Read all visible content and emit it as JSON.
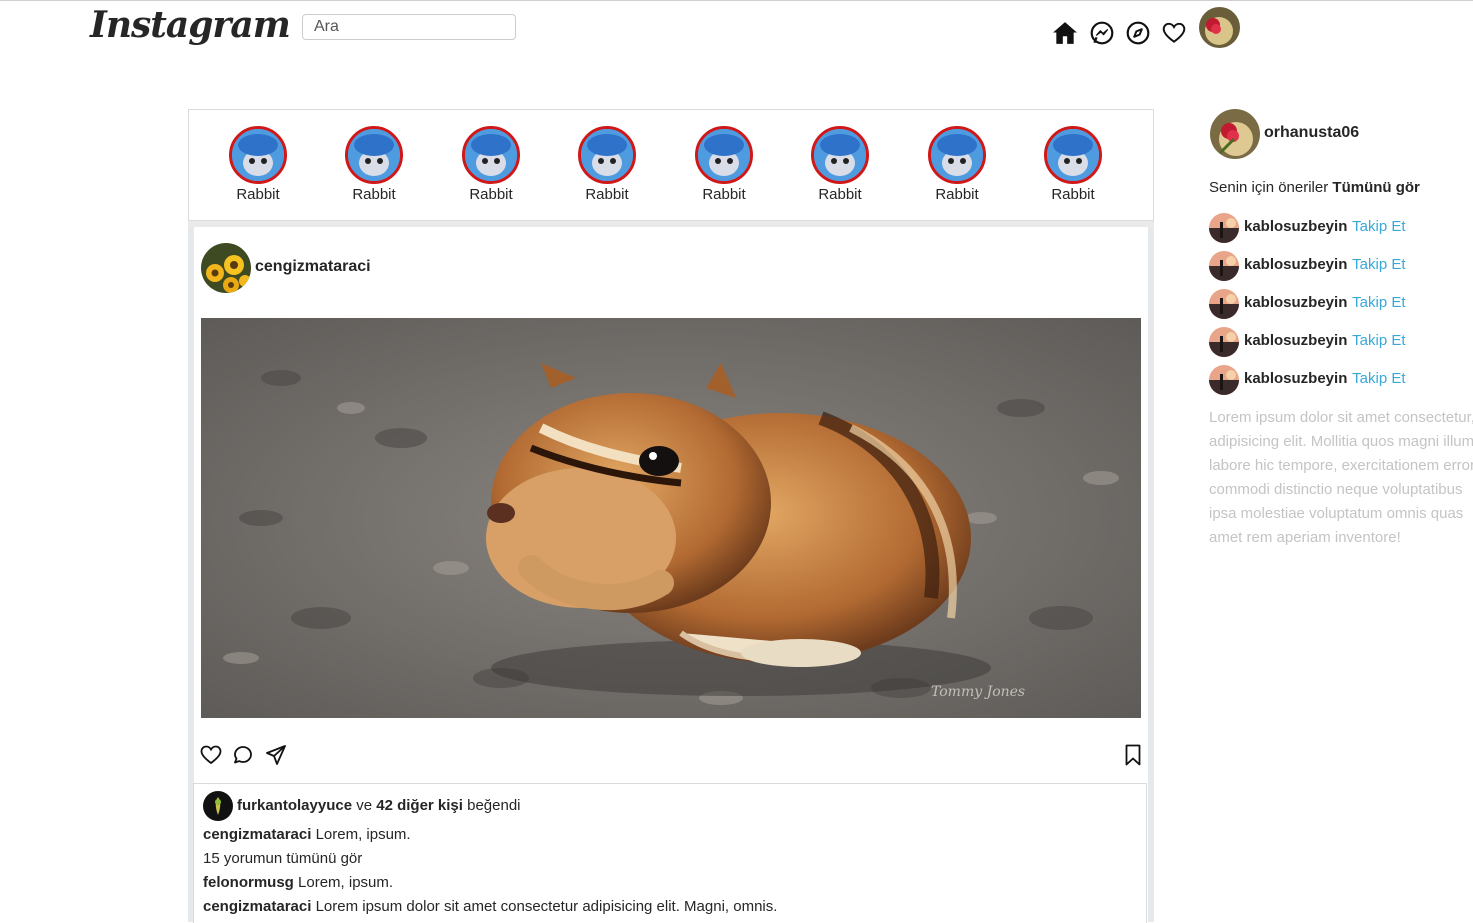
{
  "header": {
    "logo_text": "Instagram",
    "search_placeholder": "Ara",
    "icons": [
      "home-icon",
      "messenger-icon",
      "explore-icon",
      "heart-icon",
      "profile-avatar"
    ]
  },
  "stories": [
    {
      "label": "Rabbit"
    },
    {
      "label": "Rabbit"
    },
    {
      "label": "Rabbit"
    },
    {
      "label": "Rabbit"
    },
    {
      "label": "Rabbit"
    },
    {
      "label": "Rabbit"
    },
    {
      "label": "Rabbit"
    },
    {
      "label": "Rabbit"
    }
  ],
  "post": {
    "username": "cengizmataraci",
    "likes": {
      "liker": "furkantolayyuce",
      "connector": "ve",
      "others": "42 diğer kişi",
      "suffix": "beğendi"
    },
    "caption": {
      "user": "cengizmataraci",
      "text": "Lorem, ipsum."
    },
    "view_all_comments": "15 yorumun tümünü gör",
    "comments": [
      {
        "user": "felonormusg",
        "text": "Lorem, ipsum."
      },
      {
        "user": "cengizmataraci",
        "text": "Lorem ipsum dolor sit amet consectetur adipisicing elit. Magni, omnis."
      }
    ],
    "image_watermark": "Tommy Jones"
  },
  "sidebar": {
    "username": "orhanusta06",
    "suggestions_label": "Senin için öneriler",
    "see_all": "Tümünü gör",
    "suggestions": [
      {
        "username": "kablosuzbeyin",
        "action": "Takip Et"
      },
      {
        "username": "kablosuzbeyin",
        "action": "Takip Et"
      },
      {
        "username": "kablosuzbeyin",
        "action": "Takip Et"
      },
      {
        "username": "kablosuzbeyin",
        "action": "Takip Et"
      },
      {
        "username": "kablosuzbeyin",
        "action": "Takip Et"
      }
    ],
    "footer_text": "Lorem ipsum dolor sit amet consectetur, adipisicing elit. Mollitia quos magni illum labore hic tempore, exercitationem error, commodi distinctio neque voluptatibus ipsa molestiae voluptatum omnis quas amet rem aperiam inventore!"
  },
  "colors": {
    "accent_link": "#38a8d8",
    "story_ring": "#d01818",
    "muted_text": "#c4c4c4"
  }
}
